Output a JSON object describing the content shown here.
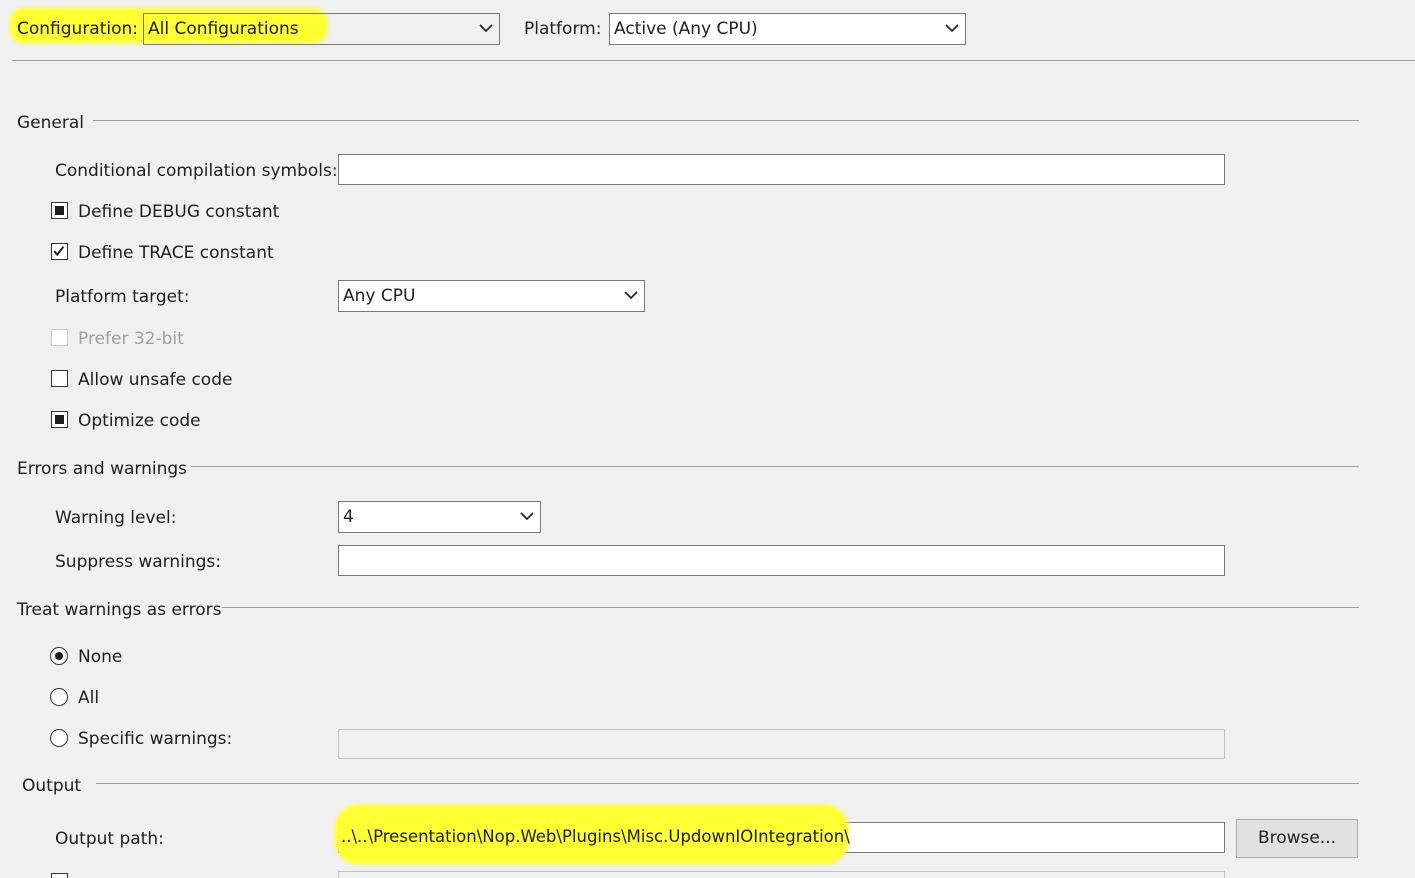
{
  "header": {
    "configuration_label": "Configuration:",
    "configuration_value": "All Configurations",
    "platform_label": "Platform:",
    "platform_value": "Active (Any CPU)"
  },
  "general": {
    "heading": "General",
    "conditional_symbols_label": "Conditional compilation symbols:",
    "conditional_symbols_value": "",
    "define_debug_label": "Define DEBUG constant",
    "define_debug_state": "indeterminate",
    "define_trace_label": "Define TRACE constant",
    "define_trace_state": "checked",
    "platform_target_label": "Platform target:",
    "platform_target_value": "Any CPU",
    "prefer32_label": "Prefer 32-bit",
    "prefer32_state": "unchecked-disabled",
    "allow_unsafe_label": "Allow unsafe code",
    "allow_unsafe_state": "unchecked",
    "optimize_label": "Optimize code",
    "optimize_state": "indeterminate"
  },
  "errors": {
    "heading": "Errors and warnings",
    "warning_level_label": "Warning level:",
    "warning_level_value": "4",
    "suppress_label": "Suppress warnings:",
    "suppress_value": ""
  },
  "treat": {
    "heading": "Treat warnings as errors",
    "none_label": "None",
    "all_label": "All",
    "specific_label": "Specific warnings:",
    "selected": "None",
    "specific_value": ""
  },
  "output": {
    "heading": "Output",
    "path_label": "Output path:",
    "path_value": "..\\..\\Presentation\\Nop.Web\\Plugins\\Misc.UpdownIOIntegration\\",
    "browse_label": "Browse..."
  },
  "colors": {
    "highlight": "#ffff33",
    "background": "#f0f0f0"
  }
}
